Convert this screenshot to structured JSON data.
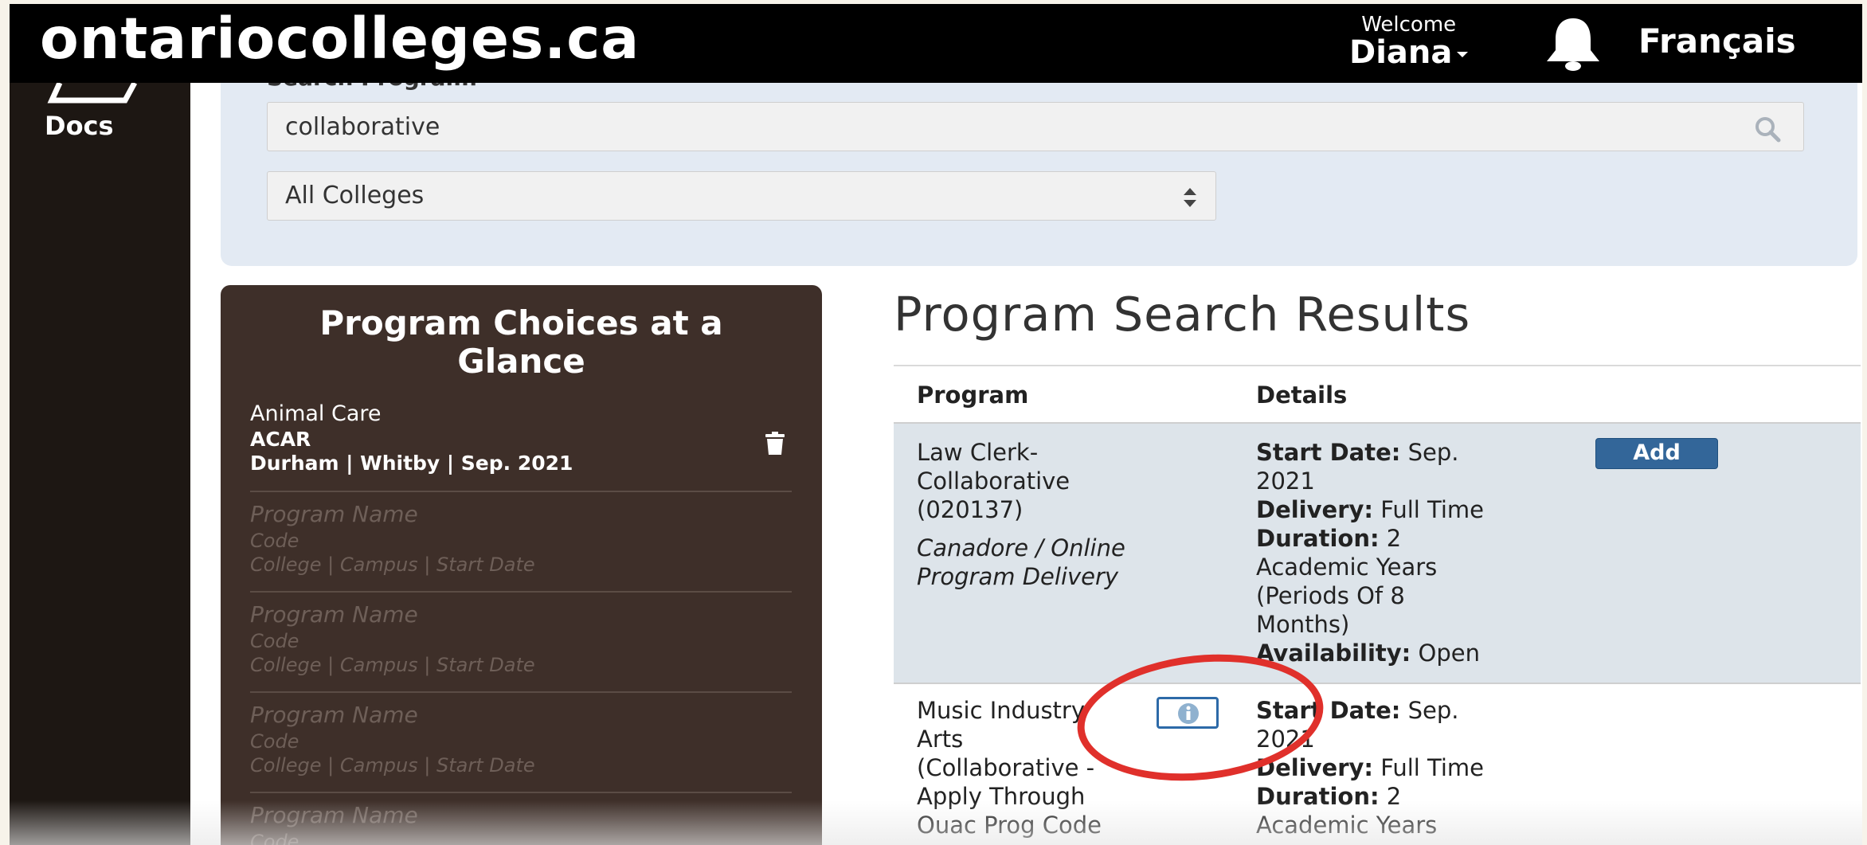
{
  "header": {
    "logo": "ontariocolleges.ca",
    "welcome_label": "Welcome",
    "user_name": "Diana",
    "language_link": "Français"
  },
  "sidebar": {
    "docs_label": "Docs"
  },
  "search": {
    "heading": "Search Program:",
    "query": "collaborative",
    "college_filter": "All Colleges"
  },
  "choices": {
    "title": "Program Choices at a Glance",
    "items": [
      {
        "name": "Animal Care",
        "code": "ACAR",
        "meta": "Durham | Whitby | Sep. 2021"
      },
      {
        "name": "Program Name",
        "code": "Code",
        "meta": "College | Campus | Start Date"
      },
      {
        "name": "Program Name",
        "code": "Code",
        "meta": "College | Campus | Start Date"
      },
      {
        "name": "Program Name",
        "code": "Code",
        "meta": "College | Campus | Start Date"
      },
      {
        "name": "Program Name",
        "code": "Code",
        "meta": "College | Campus | Start Date"
      }
    ]
  },
  "results": {
    "title": "Program Search Results",
    "col_program": "Program",
    "col_details": "Details",
    "rows": [
      {
        "name_lines": [
          "Law Clerk-",
          "Collaborative",
          "(020137)"
        ],
        "college_lines": [
          "Canadore / Online",
          "Program Delivery"
        ],
        "start_label": "Start Date:",
        "start_value_lines": [
          "Sep.",
          "2021"
        ],
        "delivery_label": "Delivery:",
        "delivery_value": "Full Time",
        "duration_label": "Duration:",
        "duration_value_lines": [
          "2",
          "Academic Years",
          "(Periods Of 8",
          "Months)"
        ],
        "availability_label": "Availability:",
        "availability_value": "Open",
        "action": "Add"
      },
      {
        "name_lines": [
          "Music Industry",
          "Arts",
          "(Collaborative -",
          "Apply Through",
          "Ouac Prog Code"
        ],
        "start_label": "Start Date:",
        "start_value_lines": [
          "Sep.",
          "2021"
        ],
        "delivery_label": "Delivery:",
        "delivery_value": "Full Time",
        "duration_label": "Duration:",
        "duration_value_lines": [
          "2",
          "Academic Years"
        ]
      }
    ]
  },
  "colors": {
    "topbar": "#000000",
    "sidebar": "#1d1713",
    "choices_panel": "#3e2f29",
    "search_panel": "#e3eaf3",
    "row_highlight": "#dde4ea",
    "add_button": "#336699",
    "annotation": "#e0302b"
  },
  "icons": [
    "folder-icon",
    "bell-icon",
    "search-icon",
    "sort-updown-icon",
    "trash-icon",
    "info-icon"
  ]
}
